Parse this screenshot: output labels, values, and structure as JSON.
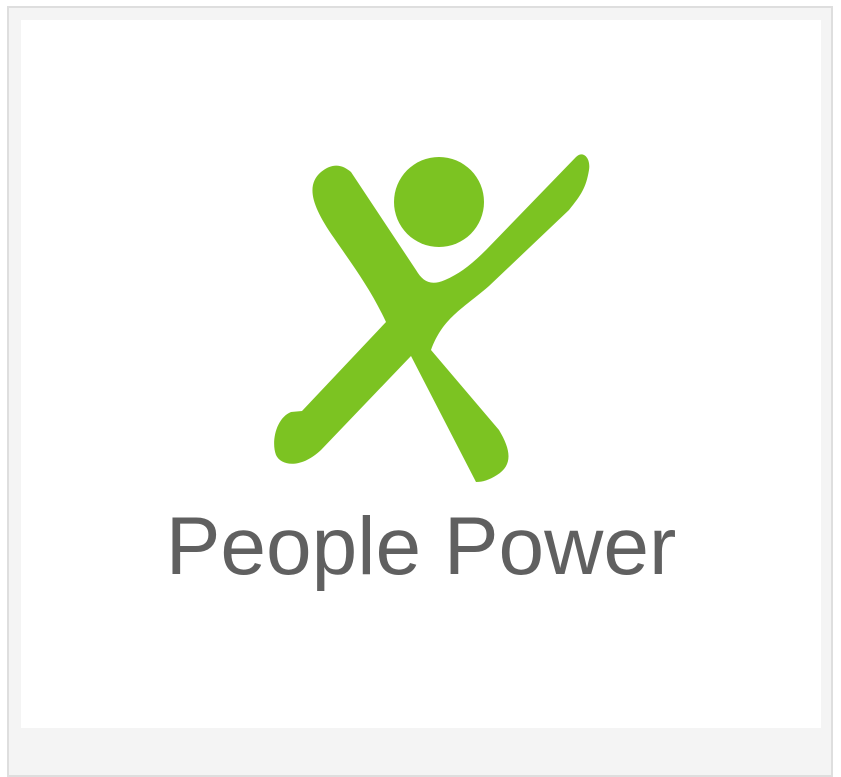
{
  "logo": {
    "wordmark": "People Power",
    "figure_icon": "person-jumping-icon",
    "figure_color": "#7cc322",
    "wordmark_color": "#606060"
  },
  "colors": {
    "card_border": "#dedede",
    "card_background": "#f4f4f4",
    "panel_background": "#ffffff"
  }
}
